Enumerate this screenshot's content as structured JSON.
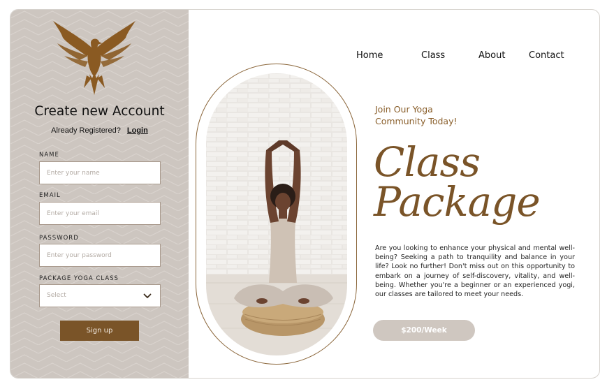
{
  "form": {
    "title": "Create new Account",
    "already_text": "Already Registered?",
    "login_link": "Login",
    "fields": [
      {
        "label": "NAME",
        "placeholder": "Enter your name"
      },
      {
        "label": "EMAIL",
        "placeholder": "Enter your email"
      },
      {
        "label": "PASSWORD",
        "placeholder": "Enter your password"
      },
      {
        "label": "PACKAGE YOGA CLASS",
        "placeholder": "Select"
      }
    ],
    "signup_label": "Sign up"
  },
  "nav": {
    "items": [
      "Home",
      "Class",
      "About",
      "Contact"
    ]
  },
  "hero": {
    "tagline_line1": "Join Our Yoga",
    "tagline_line2": "Community Today!",
    "title_line1": "Class",
    "title_line2": "Package",
    "description": "Are you looking to enhance your physical and mental well-being? Seeking a path to tranquility and balance in your life? Look no further! Don't miss out on this opportunity to embark on a journey of self-discovery, vitality, and well-being. Whether you're a beginner or an experienced yogi, our classes are tailored to meet your needs.",
    "price_label": "$200/Week"
  },
  "colors": {
    "accent_brown": "#7a5428",
    "panel_bg": "#cdc6c0",
    "price_button": "#cfc7c0"
  },
  "icons": {
    "logo": "eagle-logo-icon",
    "dropdown": "chevron-down-icon"
  }
}
